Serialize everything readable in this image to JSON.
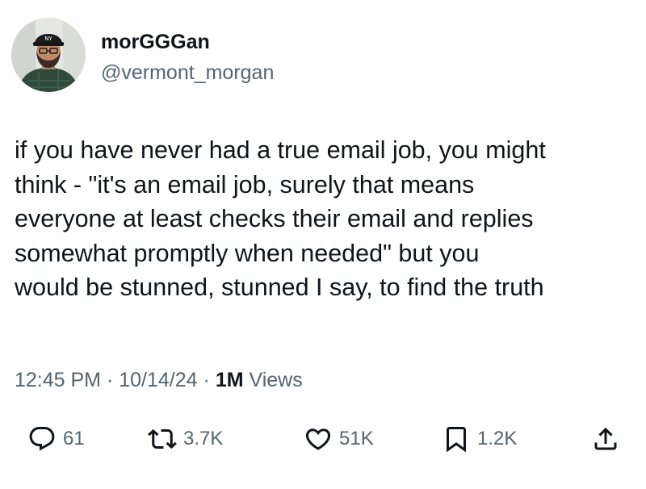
{
  "author": {
    "display_name": "morGGGan",
    "handle": "@vermont_morgan"
  },
  "tweet": {
    "lines": [
      "if you have never had a true email job, you might",
      "think - \"it's an email job, surely that means",
      "everyone at least checks their email and replies",
      "somewhat promptly when needed\" but you",
      "would be stunned, stunned I say, to find the truth"
    ]
  },
  "meta": {
    "time": "12:45 PM",
    "separator": "·",
    "date": "10/14/24",
    "views_count": "1M",
    "views_label": "Views"
  },
  "actions": {
    "replies": "61",
    "reposts": "3.7K",
    "likes": "51K",
    "bookmarks": "1.2K"
  },
  "colors": {
    "text": "#0f1419",
    "secondary": "#536471"
  },
  "icons": [
    "reply-icon",
    "repost-icon",
    "like-icon",
    "bookmark-icon",
    "share-icon"
  ]
}
